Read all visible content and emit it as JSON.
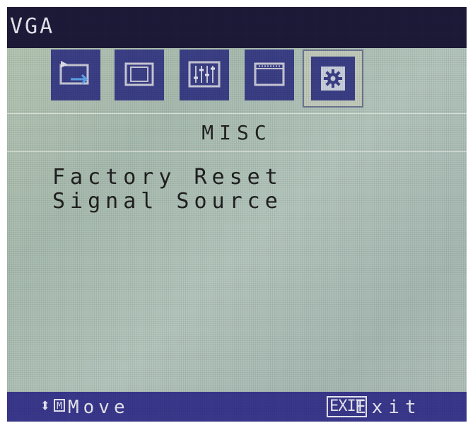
{
  "osd": {
    "input_source": "VGA",
    "tabs": [
      {
        "icon": "input-source-icon",
        "selected": false
      },
      {
        "icon": "image-position-icon",
        "selected": false
      },
      {
        "icon": "color-adjust-icon",
        "selected": false
      },
      {
        "icon": "display-setup-icon",
        "selected": false
      },
      {
        "icon": "misc-settings-icon",
        "selected": true
      }
    ],
    "section_title": "MISC",
    "menu_items": [
      "Factory Reset",
      "Signal Source"
    ],
    "footer": {
      "move_key": "M",
      "move_label": "Move",
      "exit_key": "EXIT",
      "exit_label": "Exit"
    },
    "colors": {
      "header_bg": "#1d1a3a",
      "footer_bg": "#3a388c",
      "tab_bg": "#3b3f86",
      "panel_bg": "#b0c2b6",
      "text": "#202020"
    }
  }
}
